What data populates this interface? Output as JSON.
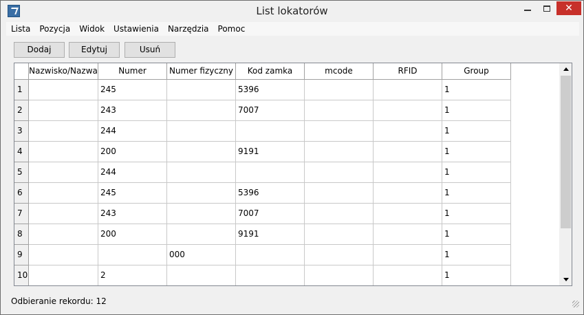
{
  "window": {
    "title": "List lokatorów"
  },
  "menu": [
    "Lista",
    "Pozycja",
    "Widok",
    "Ustawienia",
    "Narzędzia",
    "Pomoc"
  ],
  "toolbar": {
    "add_label": "Dodaj",
    "edit_label": "Edytuj",
    "delete_label": "Usuń"
  },
  "table": {
    "columns": [
      "Nazwisko/Nazwa",
      "Numer",
      "Numer fizyczny",
      "Kod zamka",
      "mcode",
      "RFID",
      "Group"
    ],
    "rows": [
      {
        "num": "1",
        "cells": [
          "",
          "245",
          "",
          "5396",
          "",
          "",
          "1"
        ]
      },
      {
        "num": "2",
        "cells": [
          "",
          "243",
          "",
          "7007",
          "",
          "",
          "1"
        ]
      },
      {
        "num": "3",
        "cells": [
          "",
          "244",
          "",
          "",
          "",
          "",
          "1"
        ]
      },
      {
        "num": "4",
        "cells": [
          "",
          "200",
          "",
          "9191",
          "",
          "",
          "1"
        ]
      },
      {
        "num": "5",
        "cells": [
          "",
          "244",
          "",
          "",
          "",
          "",
          "1"
        ]
      },
      {
        "num": "6",
        "cells": [
          "",
          "245",
          "",
          "5396",
          "",
          "",
          "1"
        ]
      },
      {
        "num": "7",
        "cells": [
          "",
          "243",
          "",
          "7007",
          "",
          "",
          "1"
        ]
      },
      {
        "num": "8",
        "cells": [
          "",
          "200",
          "",
          "9191",
          "",
          "",
          "1"
        ]
      },
      {
        "num": "9",
        "cells": [
          "",
          "",
          "000",
          "",
          "",
          "",
          "1"
        ]
      },
      {
        "num": "10",
        "cells": [
          "",
          "2",
          "",
          "",
          "",
          "",
          "1"
        ]
      }
    ]
  },
  "status": {
    "text": "Odbieranie rekordu: 12"
  },
  "icons": {
    "app": "app-icon",
    "minimize": "minimize-icon",
    "maximize": "maximize-icon",
    "close": "close-icon",
    "scroll_up": "arrow-up-icon",
    "scroll_down": "arrow-down-icon",
    "grip": "resize-grip-icon"
  },
  "colors": {
    "close_button": "#c7302a",
    "background": "#f0f0f0"
  }
}
